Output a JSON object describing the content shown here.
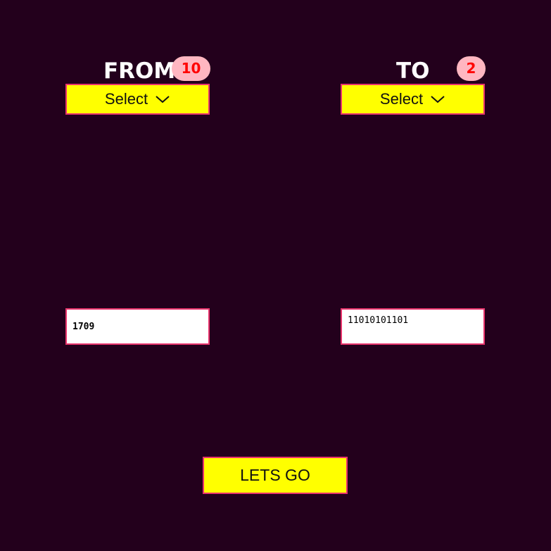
{
  "from": {
    "title": "FROM",
    "base": "10",
    "select_label": "Select",
    "input_value": "1709"
  },
  "to": {
    "title": "TO",
    "base": "2",
    "select_label": "Select",
    "output_value": "11010101101"
  },
  "action": {
    "go_label": "LETS GO"
  },
  "colors": {
    "background": "#23001c",
    "accent_yellow": "#ffff00",
    "border_pink": "#e8336c",
    "badge_bg": "#ffb6c1",
    "badge_text": "#ff0000"
  },
  "icons": {
    "select_chevron": "chevron-down-icon"
  }
}
